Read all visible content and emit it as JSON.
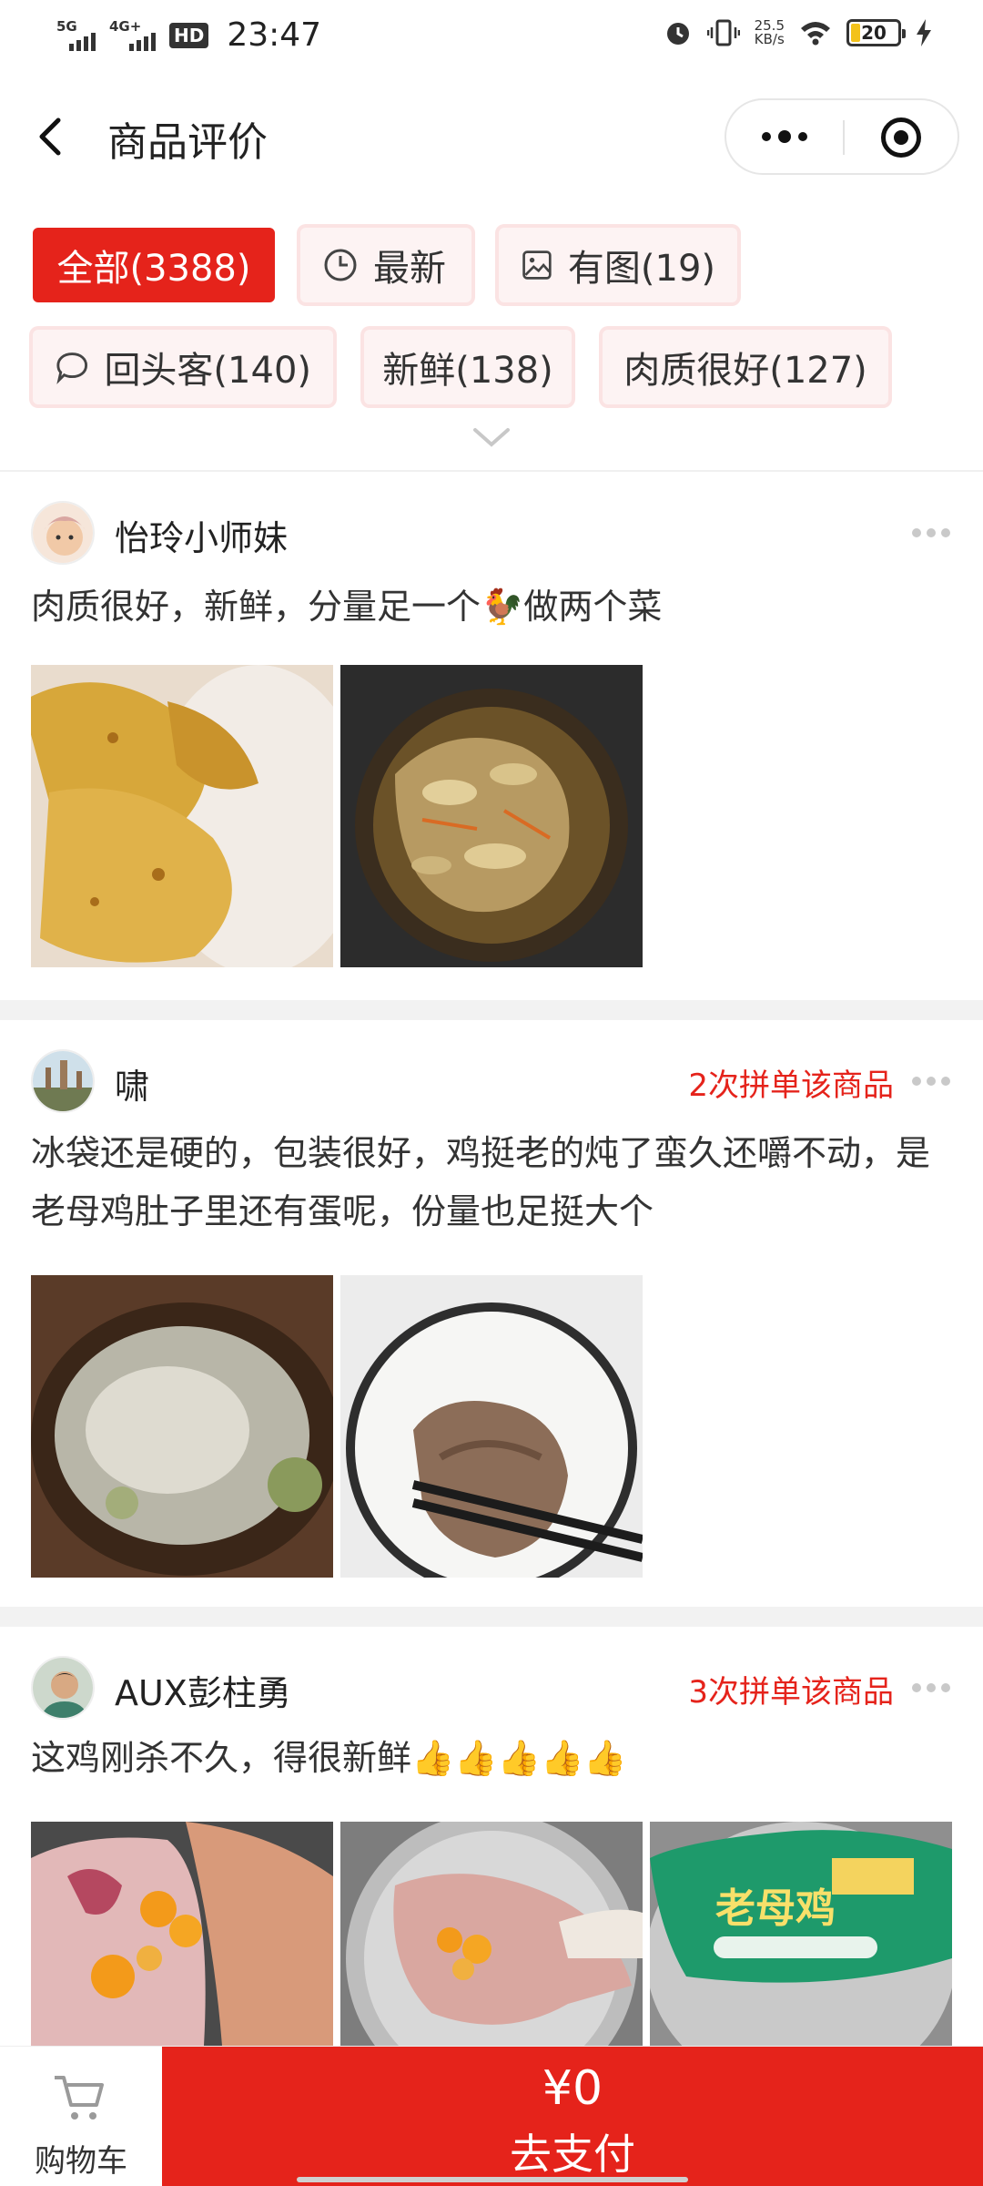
{
  "status_bar": {
    "network_1": "5G",
    "network_2": "4G+",
    "hd": "HD",
    "time": "23:47",
    "speed_value": "25.5",
    "speed_unit": "KB/s",
    "battery": "20"
  },
  "nav": {
    "title": "商品评价"
  },
  "filters": [
    {
      "label": "全部(3388)",
      "active": true
    },
    {
      "label": "最新",
      "icon": "clock-icon"
    },
    {
      "label": "有图(19)",
      "icon": "image-icon"
    },
    {
      "label": "回头客(140)",
      "icon": "chat-icon"
    },
    {
      "label": "新鲜(138)"
    },
    {
      "label": "肉质很好(127)"
    }
  ],
  "reviews": [
    {
      "username": "怡玲小师妹",
      "rebuy": "",
      "content": "肉质很好，新鲜，分量足一个🐓做两个菜",
      "photos": [
        "roast-chicken-photo",
        "mushroom-soup-photo"
      ]
    },
    {
      "username": "啸",
      "rebuy": "2次拼单该商品",
      "content": "冰袋还是硬的，包装很好，鸡挺老的炖了蛮久还嚼不动，是老母鸡肚子里还有蛋呢，份量也足挺大个",
      "photos": [
        "clay-pot-soup-photo",
        "chicken-bowl-photo"
      ]
    },
    {
      "username": "AUX彭柱勇",
      "rebuy": "3次拼单该商品",
      "content": "这鸡刚杀不久，得很新鲜👍👍👍👍👍",
      "photos": [
        "raw-chicken-eggs-photo",
        "chicken-pot-photo",
        "packaged-chicken-photo"
      ],
      "package_text": "老母鸡"
    }
  ],
  "bottom": {
    "cart_label": "购物车",
    "price": "¥0",
    "pay_label": "去支付"
  },
  "colors": {
    "accent": "#e5231b",
    "tag_bg": "#fdf3f3"
  }
}
